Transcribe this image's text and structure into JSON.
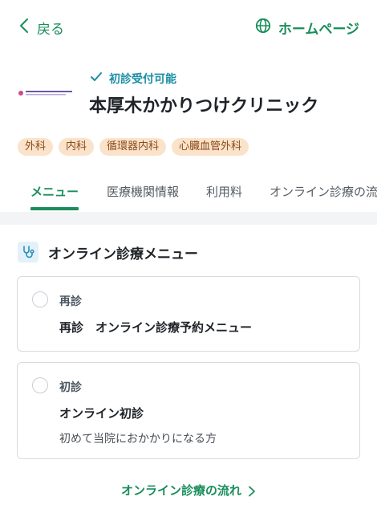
{
  "header": {
    "back_label": "戻る",
    "homepage_label": "ホームページ"
  },
  "clinic": {
    "accept_status": "初診受付可能",
    "name": "本厚木かかりつけクリニック",
    "specialties": [
      "外科",
      "内科",
      "循環器内科",
      "心臓血管外科"
    ]
  },
  "tabs": [
    {
      "label": "メニュー",
      "active": true
    },
    {
      "label": "医療機関情報",
      "active": false
    },
    {
      "label": "利用料",
      "active": false
    },
    {
      "label": "オンライン診療の流れ",
      "active": false
    }
  ],
  "menu_section": {
    "title": "オンライン診療メニュー",
    "items": [
      {
        "type": "再診",
        "title": "再診　オンライン診療予約メニュー",
        "description": ""
      },
      {
        "type": "初診",
        "title": "オンライン初診",
        "description": "初めて当院におかかりになる方"
      }
    ]
  },
  "flow_link_label": "オンライン診療の流れ",
  "colors": {
    "accent_green": "#1a8d5c",
    "accept_teal": "#1a8da5",
    "tag_bg": "#fbe3cb",
    "tag_text": "#8a4a1a"
  }
}
